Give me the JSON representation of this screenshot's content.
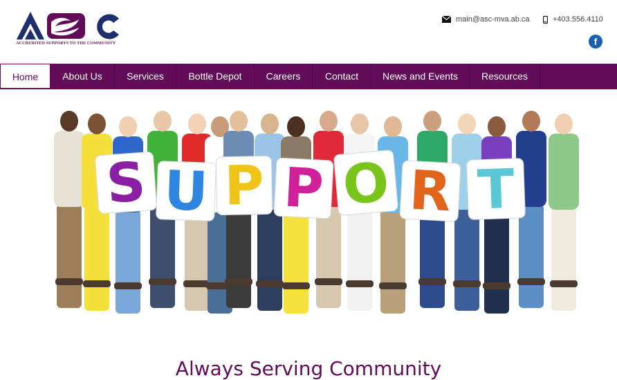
{
  "brand": {
    "logo_text": "ASC",
    "tagline": "ACCREDITED SUPPORTS TO THE COMMUNITY",
    "colors": {
      "navy": "#1e2f6e",
      "purple": "#620c59"
    }
  },
  "header": {
    "email": "main@asc-mva.ab.ca",
    "phone": "+403.556.4110",
    "email_icon": "envelope-icon",
    "phone_icon": "mobile-phone-icon",
    "social_icon": "facebook-icon",
    "social_glyph": "f"
  },
  "nav": {
    "items": [
      {
        "label": "Home",
        "active": true
      },
      {
        "label": "About Us"
      },
      {
        "label": "Services"
      },
      {
        "label": "Bottle Depot"
      },
      {
        "label": "Careers"
      },
      {
        "label": "Contact"
      },
      {
        "label": "News and Events"
      },
      {
        "label": "Resources"
      }
    ]
  },
  "hero": {
    "letters": [
      "S",
      "U",
      "P",
      "P",
      "O",
      "R",
      "T"
    ],
    "letter_colors": [
      "#8b1fa3",
      "#2f86e0",
      "#f0c419",
      "#d0219a",
      "#7ac51b",
      "#e0641a",
      "#5bc8d6"
    ]
  },
  "main": {
    "heading": "Always Serving Community"
  }
}
